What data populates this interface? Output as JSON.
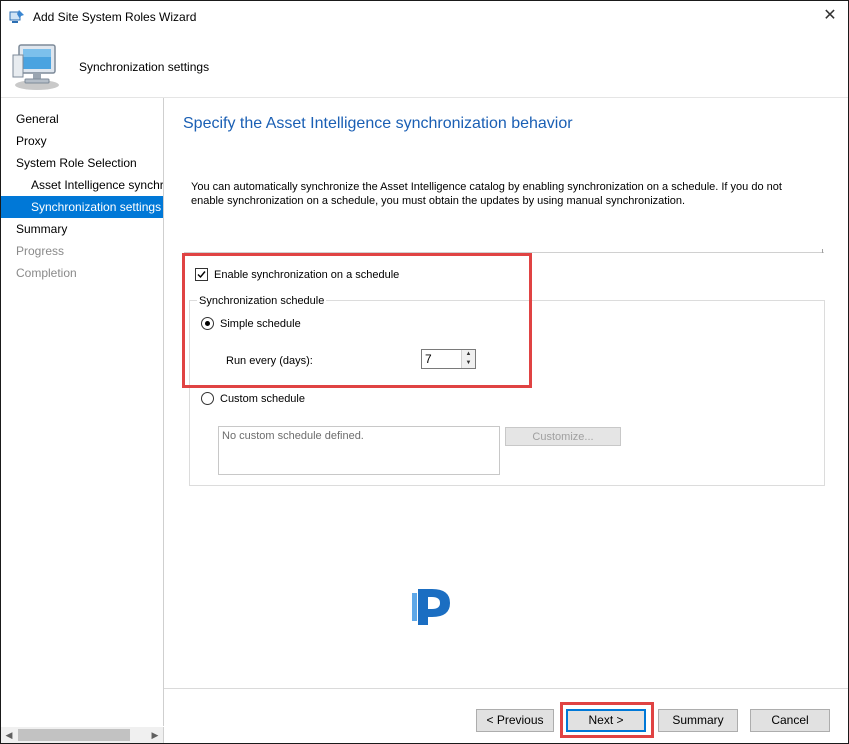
{
  "window": {
    "title": "Add Site System Roles Wizard",
    "close_glyph": "✕",
    "icon": "wizard-app-icon"
  },
  "header": {
    "title": "Synchronization settings",
    "icon": "computer-monitor-icon"
  },
  "sidebar": {
    "items": [
      {
        "label": "General",
        "state": "normal"
      },
      {
        "label": "Proxy",
        "state": "normal"
      },
      {
        "label": "System Role Selection",
        "state": "normal"
      },
      {
        "label": "Asset Intelligence synchronization point",
        "state": "normal"
      },
      {
        "label": "Synchronization settings",
        "state": "selected"
      },
      {
        "label": "Summary",
        "state": "normal"
      },
      {
        "label": "Progress",
        "state": "disabled"
      },
      {
        "label": "Completion",
        "state": "disabled"
      }
    ],
    "scroll_left": "◀",
    "scroll_right": "▶"
  },
  "main": {
    "title": "Specify the Asset Intelligence synchronization behavior",
    "description": "You can automatically synchronize the Asset Intelligence catalog by enabling synchronization on a schedule. If you do not enable synchronization on a schedule, you must obtain the updates by using manual synchronization.",
    "enable_checkbox": {
      "label": "Enable synchronization on a schedule",
      "checked": true
    },
    "schedule_group_label": "Synchronization schedule",
    "simple_radio": {
      "label": "Simple schedule",
      "selected": true
    },
    "run_every_label": "Run every (days):",
    "run_every_value": "7",
    "spin_up": "▲",
    "spin_down": "▼",
    "custom_radio": {
      "label": "Custom schedule",
      "selected": false
    },
    "custom_schedule_text": "No custom schedule defined.",
    "customize_button": "Customize..."
  },
  "footer": {
    "previous": "< Previous",
    "next": "Next >",
    "summary": "Summary",
    "cancel": "Cancel"
  },
  "colors": {
    "accent": "#0078d7",
    "title_blue": "#1a5fb4",
    "highlight_red": "#e04343"
  }
}
